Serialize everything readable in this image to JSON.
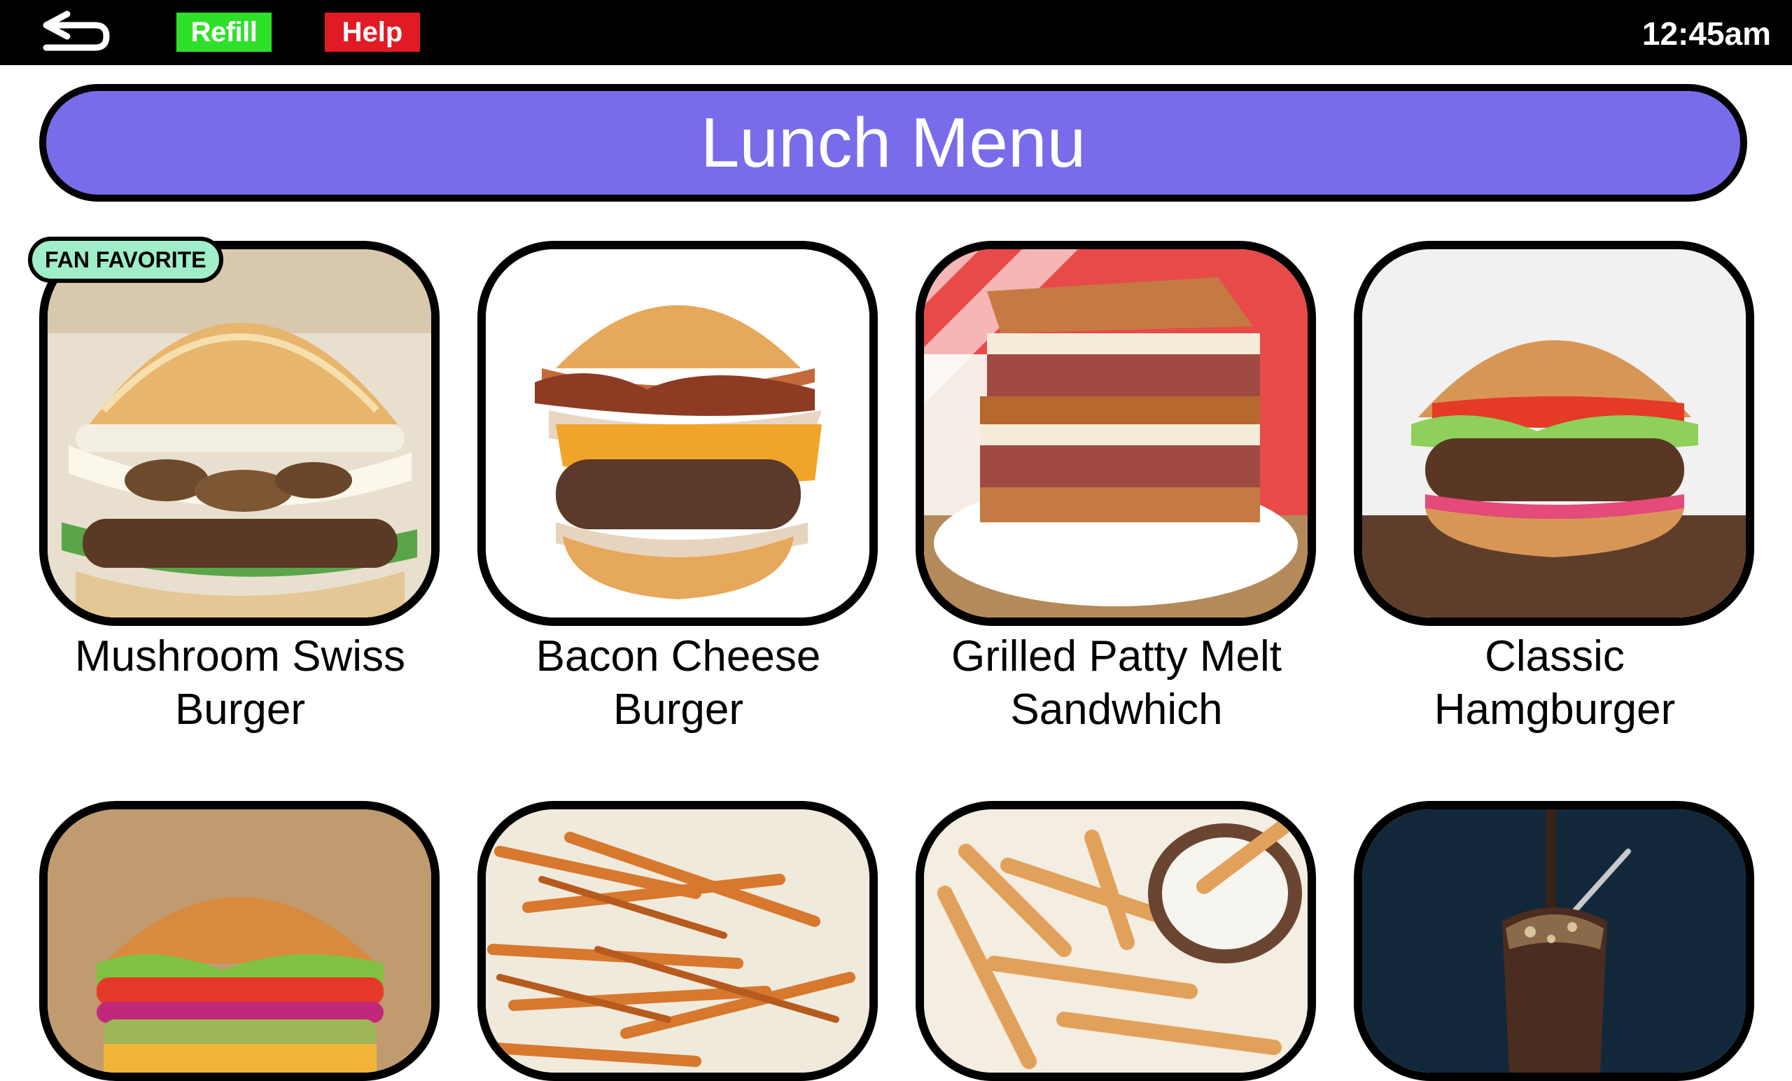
{
  "topbar": {
    "refill_label": "Refill",
    "help_label": "Help",
    "clock": "12:45am"
  },
  "title": "Lunch Menu",
  "badge": "FAN FAVORITE",
  "menu_items": [
    {
      "name": "Mushroom Swiss\nBurger"
    },
    {
      "name": "Bacon Cheese\nBurger"
    },
    {
      "name": "Grilled Patty Melt\nSandwhich"
    },
    {
      "name": "Classic\nHamgburger"
    }
  ],
  "colors": {
    "topbar": "#000000",
    "refill": "#2fe02a",
    "help": "#e21a24",
    "banner": "#786cea",
    "badge": "#a0eec8"
  }
}
